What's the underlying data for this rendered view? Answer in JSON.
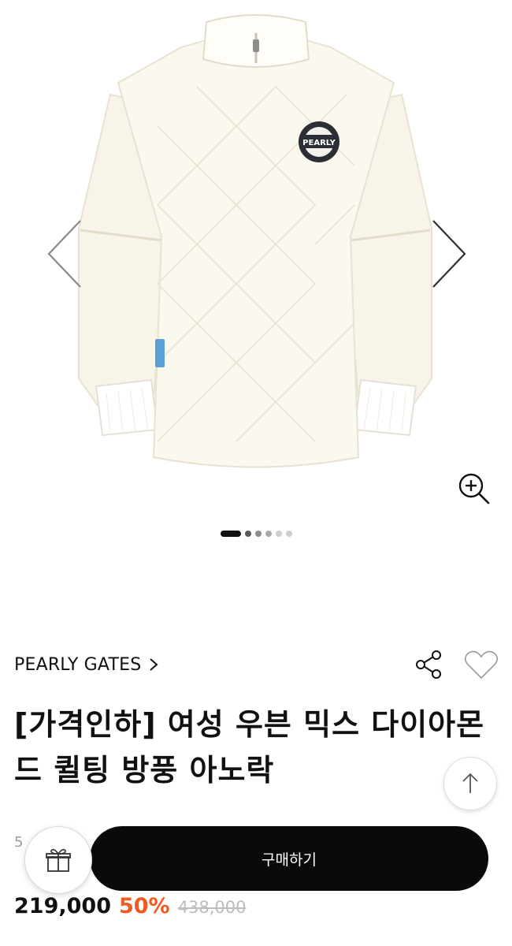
{
  "gallery": {
    "image_logo_text": "PEARLY",
    "prev_icon": "chevron-left-icon",
    "next_icon": "chevron-right-icon",
    "zoom_icon": "zoom-in-icon",
    "slide_count": 6,
    "active_slide": 1
  },
  "product": {
    "brand": "PEARLY GATES",
    "title": "[가격인하] 여성 우븐 믹스 다이아몬드 퀼팅 방풍 아노락",
    "sub_price": "5",
    "price": "219,000",
    "discount": "50%",
    "original_price": "438,000"
  },
  "actions": {
    "share_icon": "share-icon",
    "like_icon": "heart-icon",
    "top_icon": "arrow-up-icon",
    "gift_icon": "gift-icon",
    "buy_label": "구매하기"
  },
  "colors": {
    "discount": "#f05a22",
    "buy_button": "#0a0a0a",
    "product_body": "#fbf8ef"
  }
}
